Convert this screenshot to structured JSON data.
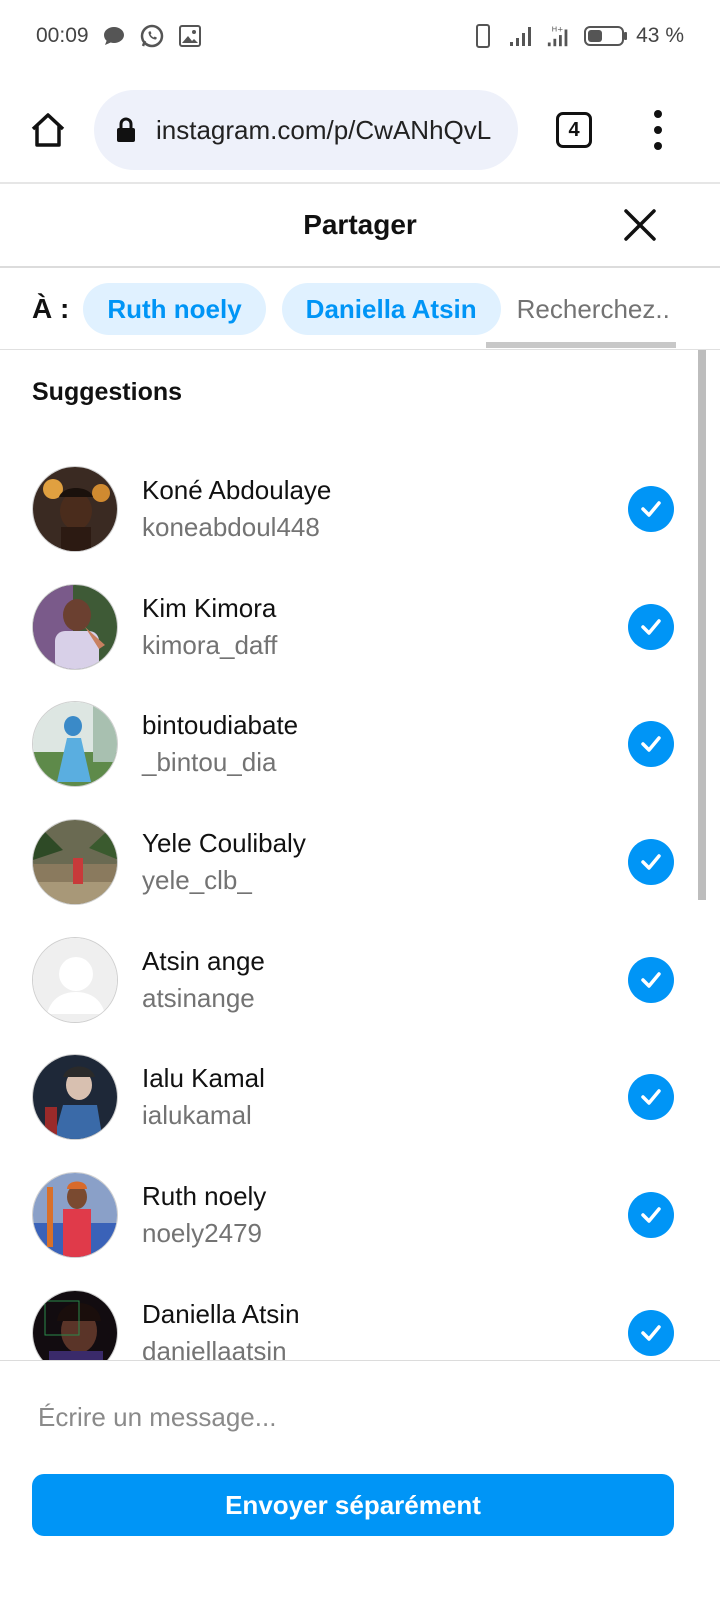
{
  "status_bar": {
    "time": "00:09",
    "battery_text": "43 %",
    "battery_level": 0.43
  },
  "browser": {
    "url": "instagram.com/p/CwANhQvL",
    "tab_count": "4"
  },
  "share": {
    "title": "Partager",
    "to_label": "À :",
    "selected_chips": [
      "Ruth noely",
      "Daniella Atsin"
    ],
    "search_placeholder": "Recherchez..",
    "suggestions_title": "Suggestions",
    "accent_color": "#0095f6"
  },
  "contacts": [
    {
      "name": "Koné Abdoulaye",
      "username": "koneabdoul448",
      "selected": true
    },
    {
      "name": "Kim Kimora",
      "username": "kimora_daff",
      "selected": true
    },
    {
      "name": "bintoudiabate",
      "username": "_bintou_dia",
      "selected": true
    },
    {
      "name": "Yele Coulibaly",
      "username": "yele_clb_",
      "selected": true
    },
    {
      "name": "Atsin ange",
      "username": "atsinange",
      "selected": true
    },
    {
      "name": "Ialu Kamal",
      "username": "ialukamal",
      "selected": true
    },
    {
      "name": "Ruth noely",
      "username": "noely2479",
      "selected": true
    },
    {
      "name": "Daniella Atsin",
      "username": "daniellaatsin",
      "selected": true
    }
  ],
  "composer": {
    "message_placeholder": "Écrire un message...",
    "send_label": "Envoyer séparément"
  }
}
